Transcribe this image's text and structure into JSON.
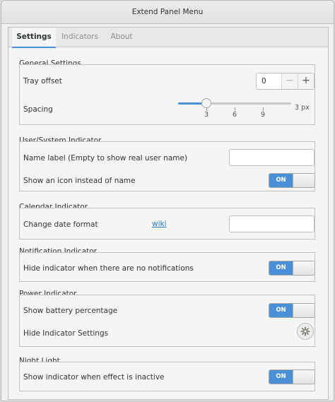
{
  "window": {
    "title": "Extend Panel Menu"
  },
  "tabs": [
    {
      "label": "Settings"
    },
    {
      "label": "Indicators"
    },
    {
      "label": "About"
    }
  ],
  "general": {
    "title": "General Settings",
    "tray_offset_label": "Tray offset",
    "tray_offset_value": "0",
    "minus": "−",
    "plus": "+",
    "spacing_label": "Spacing",
    "spacing_value_text": "3 px",
    "spacing_marks": [
      "3",
      "6",
      "9"
    ],
    "spacing_level": 3
  },
  "user_indicator": {
    "title": "User/System Indicator",
    "name_label": "Name label (Empty to show real user name)",
    "name_value": "",
    "icon_label": "Show an icon instead of name",
    "icon_switch": "ON"
  },
  "calendar": {
    "title": "Calendar Indicator",
    "date_format_label": "Change date format",
    "wiki_link": "wiki",
    "date_format_value": ""
  },
  "notification": {
    "title": "Notification Indicator",
    "hide_label": "Hide indicator when there are no notifications",
    "hide_switch": "ON"
  },
  "power": {
    "title": "Power Indicator",
    "battery_label": "Show battery percentage",
    "battery_switch": "ON",
    "hide_settings_label": "Hide Indicator Settings"
  },
  "night_light": {
    "title": "Night Light",
    "inactive_label": "Show indicator when effect is inactive",
    "inactive_switch": "ON"
  },
  "colors": {
    "accent": "#4a90d9",
    "link": "#2a76c6"
  }
}
